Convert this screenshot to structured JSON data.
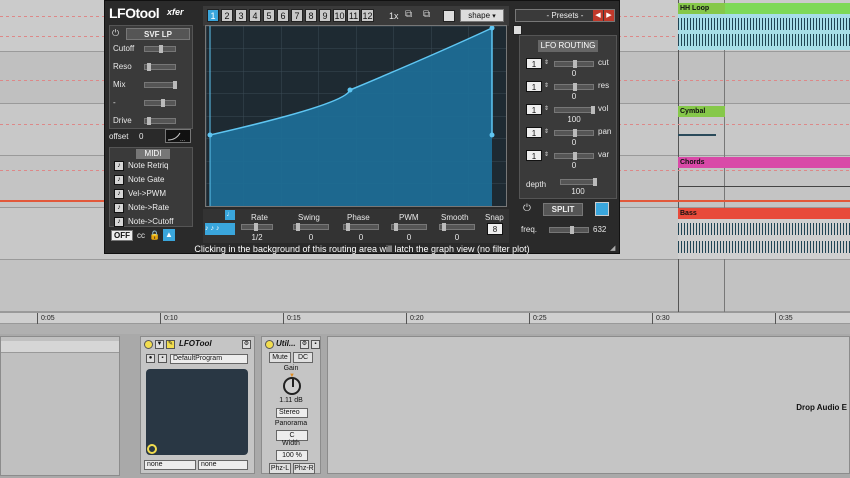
{
  "lfotool": {
    "logo": "LFOtool",
    "brand": "xfer",
    "patterns": [
      "1",
      "2",
      "3",
      "4",
      "5",
      "6",
      "7",
      "8",
      "9",
      "10",
      "11",
      "12"
    ],
    "active_pattern": "1",
    "multiplier": "1x",
    "shape_label": "shape",
    "presets_label": "- Presets -",
    "filter": {
      "type": "SVF LP",
      "cutoff_label": "Cutoff",
      "reso_label": "Reso",
      "mix_label": "Mix",
      "dash_label": "-",
      "drive_label": "Drive",
      "offset_label": "offset",
      "offset_value": "0"
    },
    "midi": {
      "title": "MIDI",
      "items": [
        "Note Retriq",
        "Note Gate",
        "Vel->PWM",
        "Note->Rate",
        "Note->Cutoff"
      ],
      "off_label": "OFF",
      "cc_label": "cc"
    },
    "params": {
      "rate": {
        "label": "Rate",
        "value": "1/2"
      },
      "swing": {
        "label": "Swing",
        "value": "0"
      },
      "phase": {
        "label": "Phase",
        "value": "0"
      },
      "pwm": {
        "label": "PWM",
        "value": "0"
      },
      "smooth": {
        "label": "Smooth",
        "value": "0"
      },
      "snap": {
        "label": "Snap",
        "value": "8"
      }
    },
    "routing": {
      "title": "LFO ROUTING",
      "rows": [
        {
          "num": "1",
          "label": "cut",
          "value": "0"
        },
        {
          "num": "1",
          "label": "res",
          "value": "0"
        },
        {
          "num": "1",
          "label": "vol",
          "value": "100"
        },
        {
          "num": "1",
          "label": "pan",
          "value": "0"
        },
        {
          "num": "1",
          "label": "var",
          "value": "0"
        }
      ],
      "depth_label": "depth",
      "depth_value": "100",
      "split_label": "SPLIT",
      "freq_label": "freq.",
      "freq_value": "632"
    },
    "status": "Clicking in the background of this routing area will latch the graph view (no filter plot)"
  },
  "tracks": {
    "hh_loop": "HH Loop",
    "cymbal": "Cymbal",
    "chords": "Chords",
    "bass": "Bass"
  },
  "colors": {
    "hh": "#7ed957",
    "cymbal": "#86c84a",
    "chords": "#d94aa8",
    "bass": "#e84a3a",
    "clip_bg": "#a6dde8"
  },
  "ruler": [
    "0:05",
    "0:10",
    "0:15",
    "0:20",
    "0:25",
    "0:30",
    "0:35"
  ],
  "devices": {
    "lfotool": {
      "name": "LFOTool",
      "program": "DefaultProgram",
      "sel1": "none",
      "sel2": "none"
    },
    "utility": {
      "name": "Util...",
      "mute": "Mute",
      "dc": "DC",
      "gain_label": "Gain",
      "gain_value": "1.11 dB",
      "stereo": "Stereo",
      "panorama_label": "Panorama",
      "panorama_value": "C",
      "width_label": "Width",
      "width_value": "100 %",
      "phzl": "Phz-L",
      "phzr": "Phz-R"
    },
    "drop_hint": "Drop Audio E"
  }
}
